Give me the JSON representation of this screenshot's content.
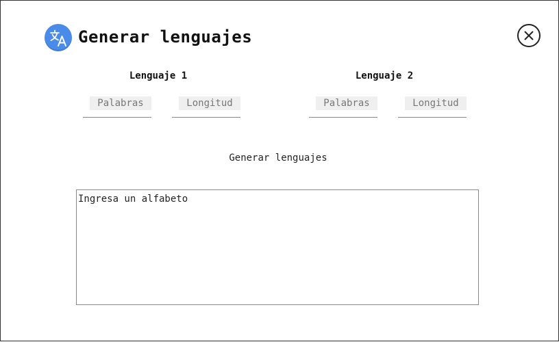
{
  "header": {
    "title": "Generar lenguajes",
    "logo_icon": "translate-icon",
    "close_icon": "close-circle-icon"
  },
  "languages": [
    {
      "heading": "Lenguaje 1",
      "words_placeholder": "Palabras",
      "length_placeholder": "Longitud"
    },
    {
      "heading": "Lenguaje 2",
      "words_placeholder": "Palabras",
      "length_placeholder": "Longitud"
    }
  ],
  "generate_button_label": "Generar lenguajes",
  "alphabet_input": {
    "placeholder": "Ingresa un alfabeto",
    "value": ""
  },
  "colors": {
    "logo_background": "#4a8ae8",
    "input_background": "#efefef",
    "border": "#888888"
  }
}
